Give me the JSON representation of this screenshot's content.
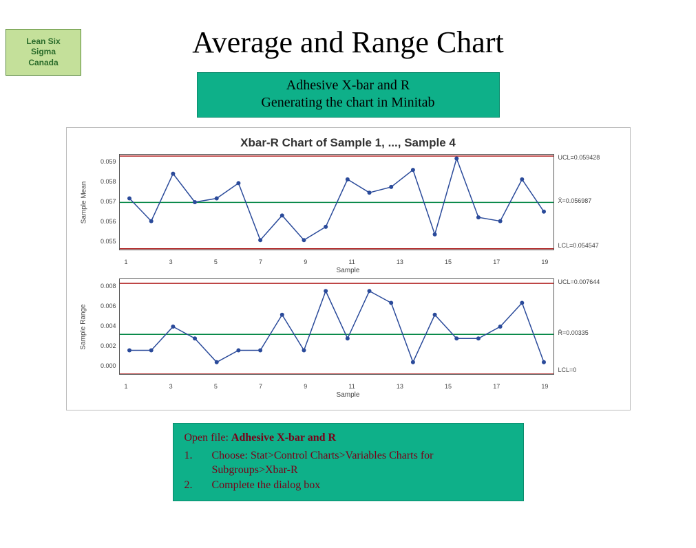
{
  "logo": {
    "line1": "Lean Six",
    "line2": "Sigma",
    "line3": "Canada"
  },
  "title": "Average and Range Chart",
  "subtitle": {
    "line1": "Adhesive X-bar and R",
    "line2": "Generating the chart in Minitab"
  },
  "chart_card_title": "Xbar-R Chart of Sample 1, ..., Sample 4",
  "instructions": {
    "open_prefix": "Open file: ",
    "open_file": "Adhesive X-bar and R",
    "steps": [
      {
        "num": "1.",
        "text": "Choose: Stat>Control Charts>Variables Charts for Subgroups>Xbar-R"
      },
      {
        "num": "2.",
        "text": "Complete the dialog box"
      }
    ]
  },
  "chart_data": [
    {
      "type": "line",
      "name": "Xbar",
      "ylabel": "Sample Mean",
      "xlabel": "Sample",
      "x": [
        1,
        2,
        3,
        4,
        5,
        6,
        7,
        8,
        9,
        10,
        11,
        12,
        13,
        14,
        15,
        16,
        17,
        18,
        19,
        20
      ],
      "values": [
        0.0572,
        0.056,
        0.0585,
        0.057,
        0.0572,
        0.058,
        0.055,
        0.0563,
        0.055,
        0.0557,
        0.0582,
        0.0575,
        0.0578,
        0.0587,
        0.0553,
        0.0593,
        0.0562,
        0.056,
        0.0582,
        0.0565
      ],
      "ucl": 0.059428,
      "center": 0.056987,
      "lcl": 0.054547,
      "ylim": [
        0.0545,
        0.0595
      ],
      "yticks": [
        0.055,
        0.056,
        0.057,
        0.058,
        0.059
      ],
      "xticks": [
        1,
        3,
        5,
        7,
        9,
        11,
        13,
        15,
        17,
        19
      ],
      "ucl_label": "UCL=0.059428",
      "center_label": "X̄=0.056987",
      "lcl_label": "LCL=0.054547"
    },
    {
      "type": "line",
      "name": "R",
      "ylabel": "Sample Range",
      "xlabel": "Sample",
      "x": [
        1,
        2,
        3,
        4,
        5,
        6,
        7,
        8,
        9,
        10,
        11,
        12,
        13,
        14,
        15,
        16,
        17,
        18,
        19,
        20
      ],
      "values": [
        0.002,
        0.002,
        0.004,
        0.003,
        0.001,
        0.002,
        0.002,
        0.005,
        0.002,
        0.007,
        0.003,
        0.007,
        0.006,
        0.001,
        0.005,
        0.003,
        0.003,
        0.004,
        0.006,
        0.001
      ],
      "ucl": 0.007644,
      "center": 0.00335,
      "lcl": 0,
      "ylim": [
        0,
        0.008
      ],
      "yticks": [
        0.0,
        0.002,
        0.004,
        0.006,
        0.008
      ],
      "xticks": [
        1,
        3,
        5,
        7,
        9,
        11,
        13,
        15,
        17,
        19
      ],
      "ucl_label": "UCL=0.007644",
      "center_label": "R̄=0.00335",
      "lcl_label": "LCL=0"
    }
  ]
}
